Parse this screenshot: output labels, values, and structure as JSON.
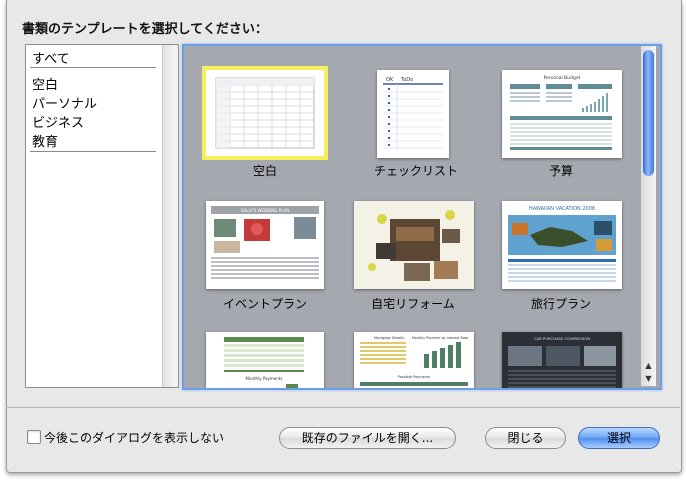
{
  "dialog": {
    "prompt": "書類のテンプレートを選択してください：",
    "categories": [
      "すべて",
      "空白",
      "パーソナル",
      "ビジネス",
      "教育"
    ],
    "templates": [
      {
        "label": "空白"
      },
      {
        "label": "チェックリスト"
      },
      {
        "label": "予算"
      },
      {
        "label": "イベントプラン"
      },
      {
        "label": "自宅リフォーム"
      },
      {
        "label": "旅行プラン"
      }
    ],
    "checkbox_label": "今後このダイアログを表示しない",
    "open_existing_label": "既存のファイルを開く...",
    "close_label": "閉じる",
    "select_label": "選択"
  },
  "thumb_text": {
    "checklist_done": "OK",
    "checklist_col2": "ToDo",
    "checklist_col3": "To-do",
    "budget_title": "Personal Budget",
    "event_title": "SALLY'S WEDDING PLAN",
    "travel_title": "HAWAIIAN VACATION 2008",
    "mortgage_title": "Mortgage Details",
    "mortgage_chart": "Monthly Payment by Interest Rate",
    "mortgage_payments": "Possible Payments",
    "loan_heading": "Monthly Payments",
    "car_title": "CAR PURCHASE COMPARISON"
  },
  "colors": {
    "selected_border": "#f4ef5a",
    "gallery_bg": "#a6a8b0",
    "focus_ring": "#6d9ee6",
    "primary_button": "#4f8ef0"
  }
}
